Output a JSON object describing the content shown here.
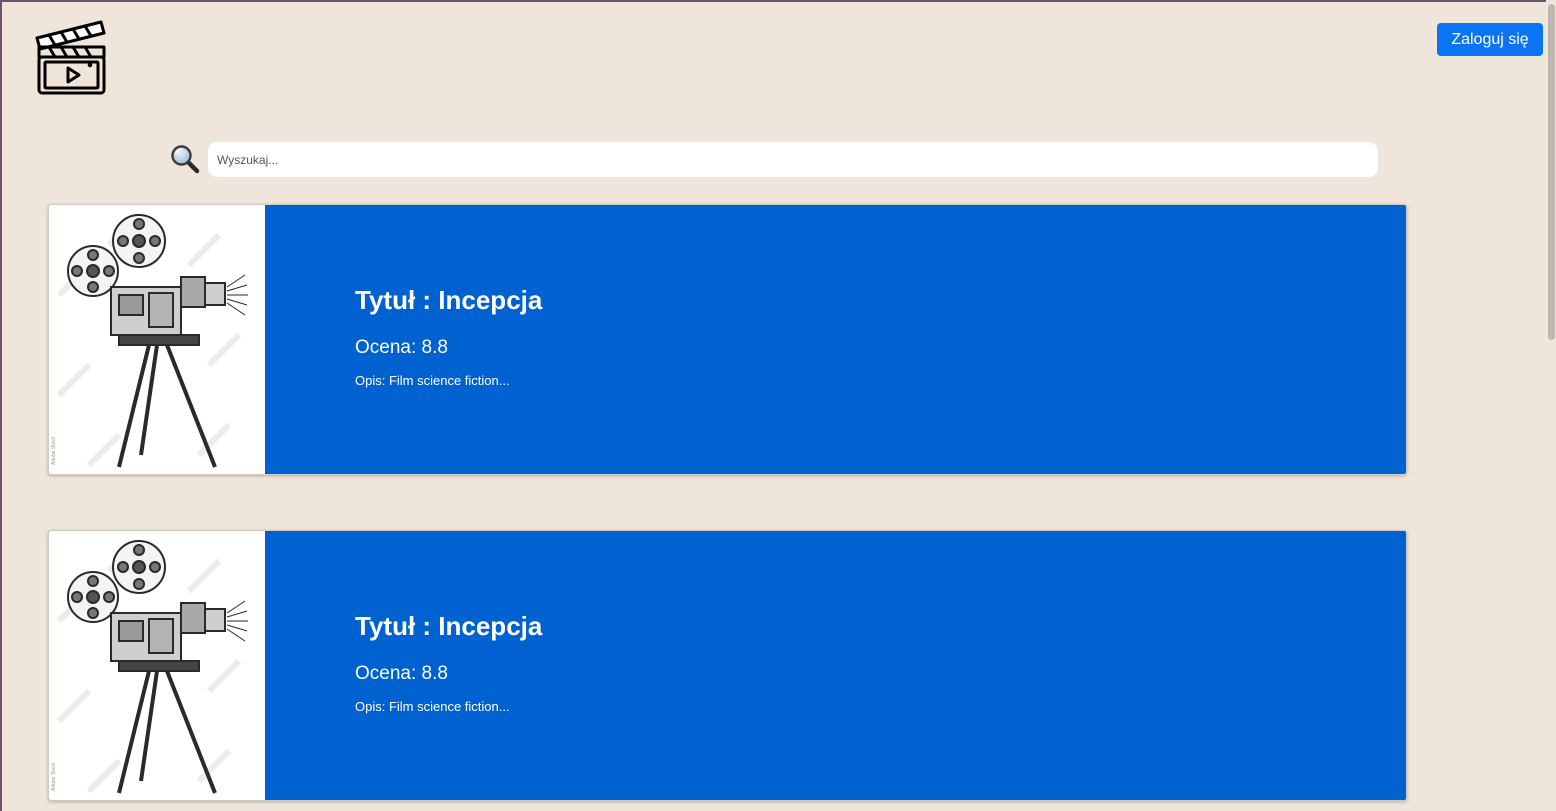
{
  "header": {
    "logo_icon": "clapperboard-play-icon",
    "login_label": "Zaloguj się"
  },
  "search": {
    "icon": "magnifier-icon",
    "placeholder": "Wyszukaj...",
    "value": ""
  },
  "movies": [
    {
      "image_icon": "vintage-film-camera-illustration",
      "title": "Tytuł : Incepcja",
      "rating": "Ocena: 8.8",
      "description": "Opis: Film science fiction..."
    },
    {
      "image_icon": "vintage-film-camera-illustration",
      "title": "Tytuł : Incepcja",
      "rating": "Ocena: 8.8",
      "description": "Opis: Film science fiction..."
    }
  ],
  "colors": {
    "background": "#efe5da",
    "card": "#0062d1",
    "button": "#0b74f5",
    "text_on_card": "#ffffff"
  }
}
